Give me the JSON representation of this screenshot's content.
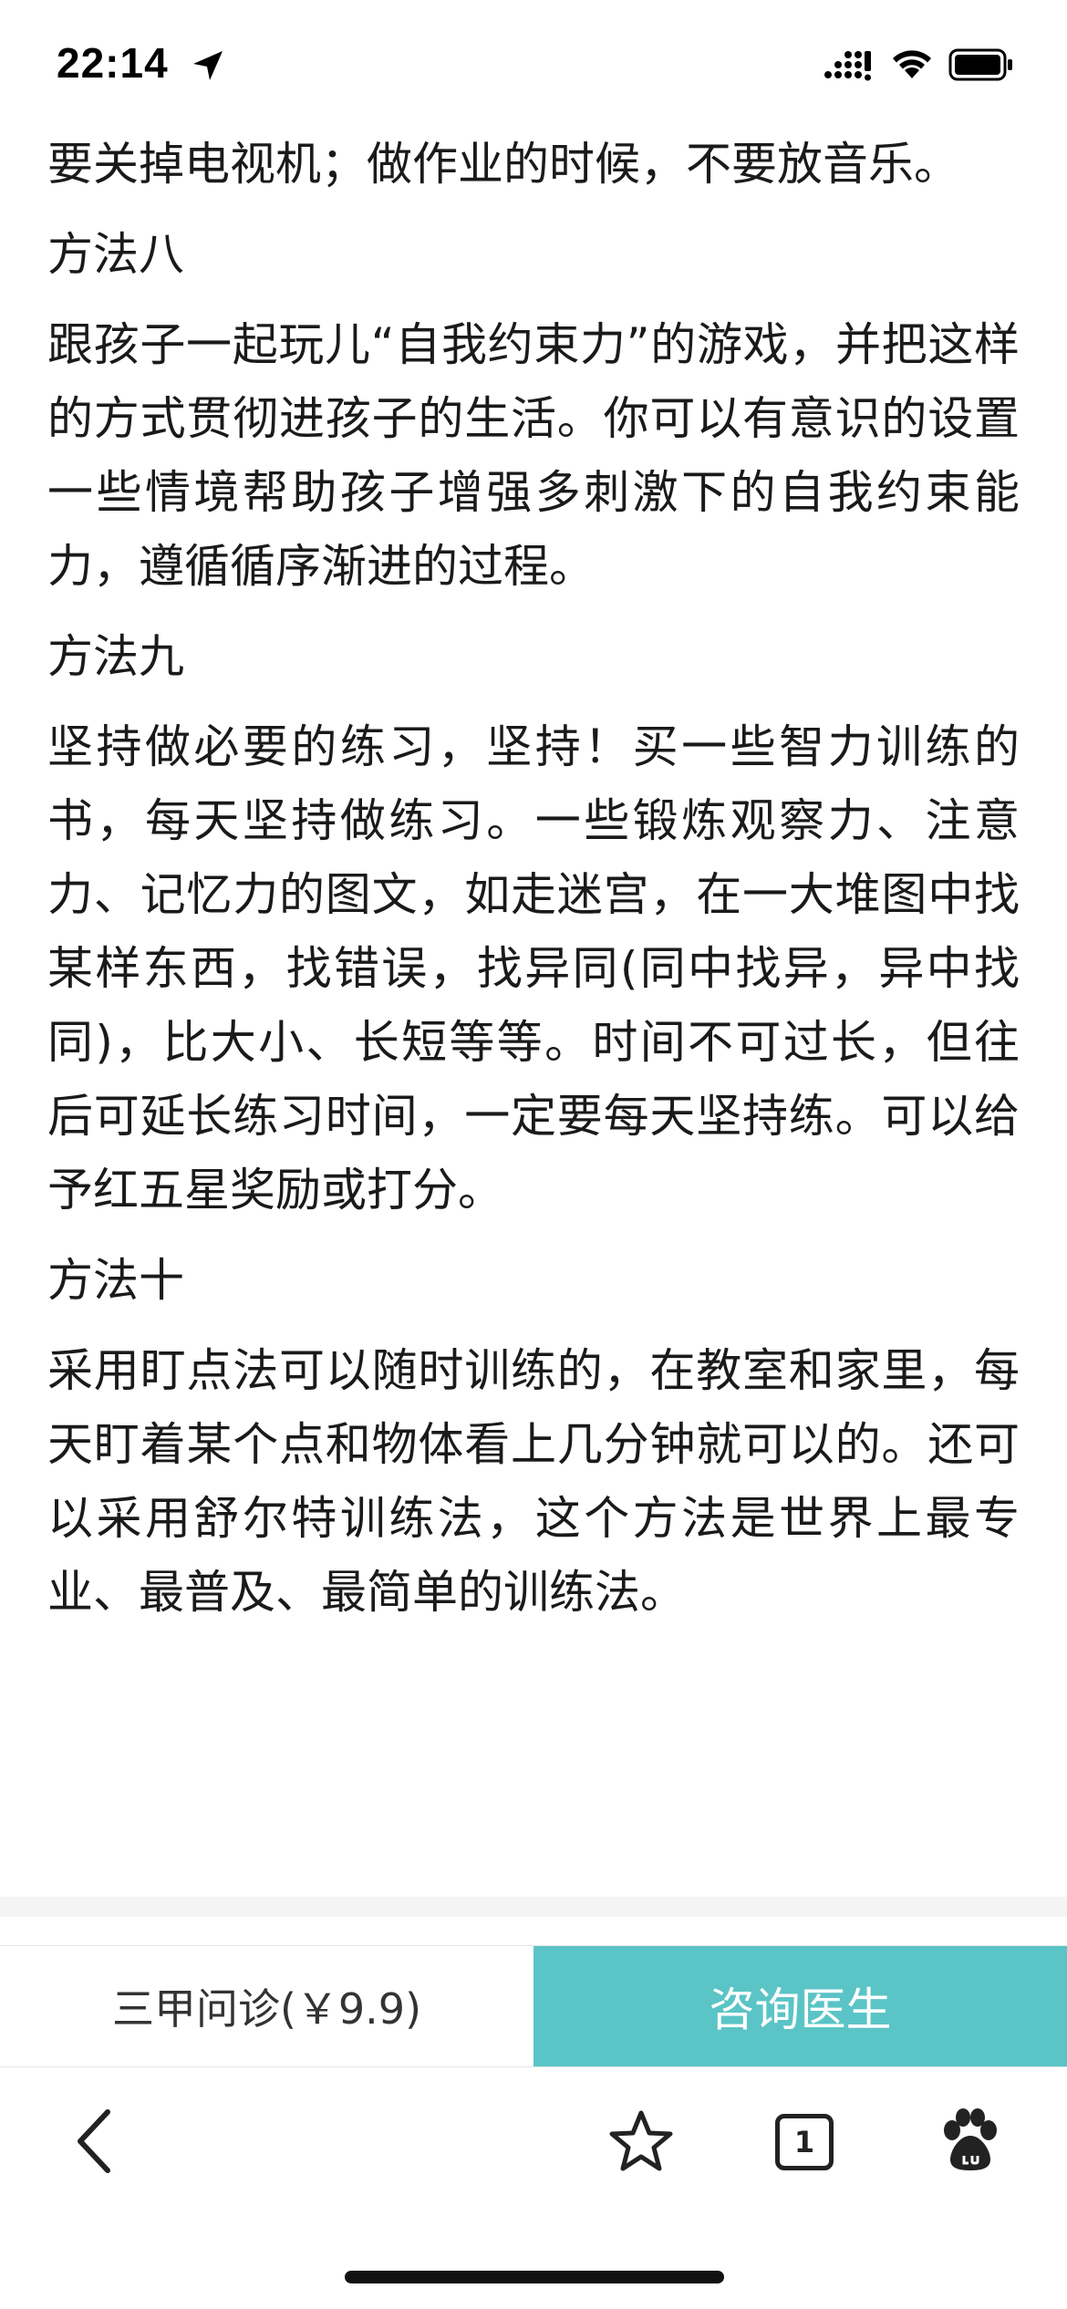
{
  "status_bar": {
    "time": "22:14",
    "icons": [
      "location-arrow-icon",
      "cellular-signal-icon",
      "wifi-icon",
      "battery-icon"
    ]
  },
  "article": {
    "blocks": [
      {
        "type": "para",
        "text": "要关掉电视机；做作业的时候，不要放音乐。"
      },
      {
        "type": "heading",
        "text": "方法八"
      },
      {
        "type": "para",
        "text": "跟孩子一起玩儿“自我约束力”的游戏，并把这样的方式贯彻进孩子的生活。你可以有意识的设置一些情境帮助孩子增强多刺激下的自我约束能力，遵循循序渐进的过程。"
      },
      {
        "type": "heading",
        "text": "方法九"
      },
      {
        "type": "para",
        "text": "坚持做必要的练习，坚持！买一些智力训练的书，每天坚持做练习。一些锻炼观察力、注意力、记忆力的图文，如走迷宫，在一大堆图中找某样东西，找错误，找异同(同中找异，异中找同)，比大小、长短等等。时间不可过长，但往后可延长练习时间，一定要每天坚持练。可以给予红五星奖励或打分。"
      },
      {
        "type": "heading",
        "text": "方法十"
      },
      {
        "type": "para",
        "text": "采用盯点法可以随时训练的，在教室和家里，每天盯着某个点和物体看上几分钟就可以的。还可以采用舒尔特训练法，这个方法是世界上最专业、最普及、最简单的训练法。"
      }
    ]
  },
  "consult": {
    "left_label": "三甲问诊(￥9.9)",
    "right_label": "咨询医生",
    "accent_color": "#5bc4c6"
  },
  "toolbar": {
    "tab_count": "1",
    "icons": [
      "back-chevron-icon",
      "star-icon",
      "tabs-icon",
      "baidu-paw-icon"
    ]
  }
}
